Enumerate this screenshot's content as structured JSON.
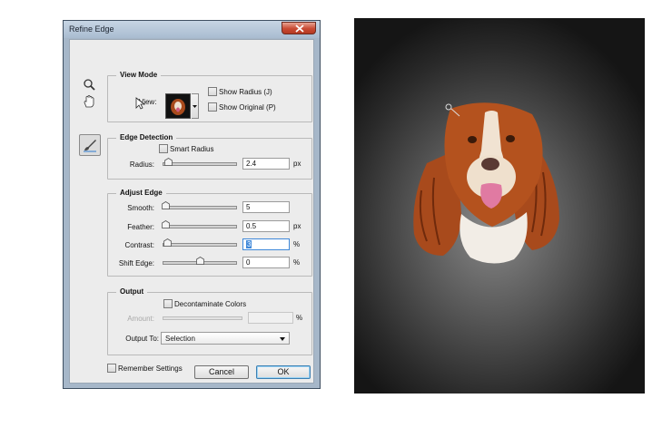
{
  "dialog": {
    "title": "Refine Edge"
  },
  "view_mode": {
    "title": "View Mode",
    "view_label": "View:",
    "show_radius": "Show Radius (J)",
    "show_original": "Show Original (P)"
  },
  "edge_detection": {
    "title": "Edge Detection",
    "smart_radius": "Smart Radius",
    "radius_label": "Radius:",
    "radius_value": "2.4",
    "radius_unit": "px"
  },
  "adjust_edge": {
    "title": "Adjust Edge",
    "smooth_label": "Smooth:",
    "smooth_value": "5",
    "feather_label": "Feather:",
    "feather_value": "0.5",
    "feather_unit": "px",
    "contrast_label": "Contrast:",
    "contrast_value": "3",
    "contrast_unit": "%",
    "shift_label": "Shift Edge:",
    "shift_value": "0",
    "shift_unit": "%"
  },
  "output": {
    "title": "Output",
    "decontaminate": "Decontaminate Colors",
    "amount_label": "Amount:",
    "amount_value": "",
    "amount_unit": "%",
    "output_to_label": "Output To:",
    "output_to_value": "Selection"
  },
  "footer": {
    "remember": "Remember Settings",
    "cancel": "Cancel",
    "ok": "OK"
  },
  "icons": [
    "zoom-icon",
    "hand-icon",
    "refine-radius-brush-icon",
    "cursor-icon",
    "close-icon"
  ],
  "colors": {
    "title_bar": "#a9bcd0",
    "close_button": "#c94a33",
    "dialog_face": "#ececec",
    "ok_border": "#3c7fb1",
    "dog_fur": "#b4521e"
  }
}
